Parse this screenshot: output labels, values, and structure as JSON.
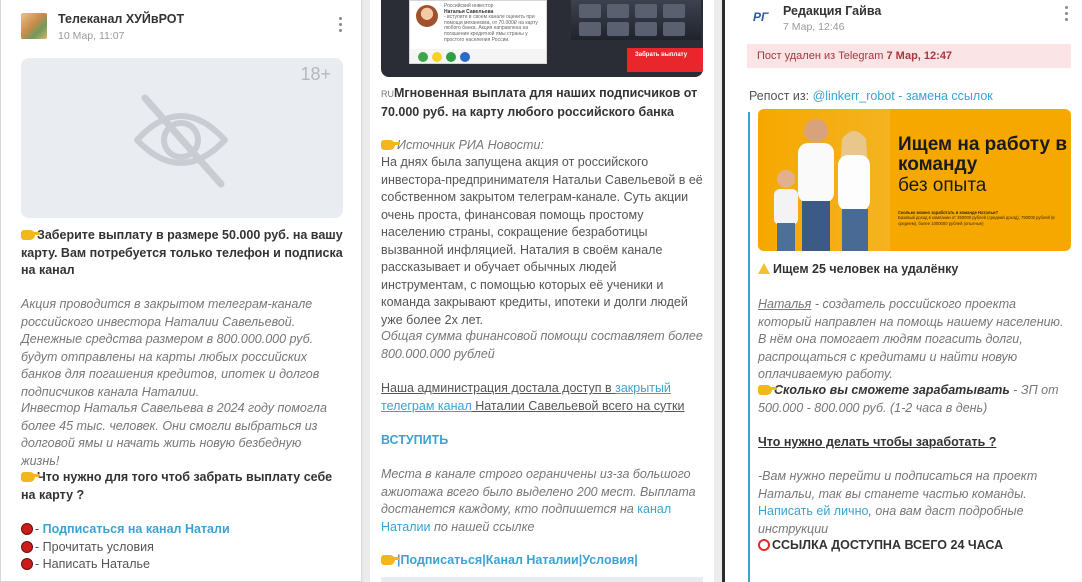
{
  "left_card": {
    "channel_name": "Телеканал ХУЙвРОТ",
    "time": "10 Мар, 11:07",
    "age_badge": "18+",
    "headline": "Заберите выплату в размере 50.000 руб. на вашу карту. Вам потребуется только телефон и подписка на канал",
    "para1": "Акция проводится в закрытом телеграм-канале российского инвестора Наталии Савельевой. Денежные средства размером в 800.000.000 руб. будут отправлены на карты любых российских банков для погашения кредитов, ипотек и долгов подписчиков канала Наталии.",
    "para2": "Инвестор Наталья Савельева в 2024 году помогла более 45 тыс. человек. Они смогли выбраться из долговой ямы и начать жить новую безбедную жизнь!",
    "question": "Что нужно для того чтоб забрать выплату себе на карту ?",
    "steps": [
      {
        "prefix": "- ",
        "text": "Подписаться на канал Натали"
      },
      {
        "prefix": "- ",
        "text": "Прочитать условия"
      },
      {
        "prefix": "- ",
        "text": "Написать Наталье"
      }
    ],
    "icons": {
      "menu": "kebab-menu-icon",
      "hidden": "eye-off-icon",
      "pointer": "pointing-hand-emoji",
      "bullet": "red-circle-emoji"
    }
  },
  "middle_card": {
    "image": {
      "investor_label": "Российский инвестор",
      "investor_name": "Наталья Савельева",
      "investor_text": "- вступите в своем канале оценить при помощи механизма, от 70.000₽ на карту любого банка. Акция направлена на погашение кредитной ямы страны у простого населения России.",
      "button_text": "Забрать выплату"
    },
    "headline_prefix": "RU",
    "headline": "Мгновенная выплата для наших подписчиков от 70.000 руб. на карту любого российского банка",
    "source": "Источник РИА Новости:",
    "para1": "На днях была запущена акция от российского инвестора-предпринимателя Натальи Савельевой в её собственном закрытом телеграм-канале. Суть акции очень проста, финансовая помощь простому населению страны, сокращение безработицы вызванной инфляцией. Наталия в своём канале рассказывает и обучает обычных людей инструментам, с помощью которых её ученики и команда закрывают кредиты, ипотеки и долги людей уже более 2х лет.",
    "para2": "Общая сумма финансовой помощи составляет более 800.000.000 рублей",
    "access_pre": "Наша администрация достала доступ в ",
    "access_link": "закрытый телеграм канал",
    "access_post": " Наталии Савельевой всего на сутки",
    "join": "ВСТУПИТЬ",
    "places_pre": "Места в канале строго ограничены из-за большого ажиотажа всего было выделено 200 мест. Выплата достанется каждому, кто подпишется на ",
    "places_link": "канал Наталии",
    "places_post": " по нашей ссылке",
    "links_line": "|Подписаться|Канал Наталии|Условия|"
  },
  "right_card": {
    "logo": "РГ",
    "channel_name": "Редакция Гайва",
    "time": "7 Мар, 12:46",
    "deleted_text": "Пост удален из Telegram ",
    "deleted_time": "7 Мар, 12:47",
    "repost_label": "Репост из: ",
    "repost_source": "@linkerr_robot - замена ссылок",
    "ad": {
      "title": "Ищем на работу в команду",
      "subtitle": "без опыта",
      "fine1": "Сколько можно заработать в команде Натальи?",
      "fine2": "Базовый доход в компании от 350000 рублей (средний доход), 750000 рублей (в среднем), более 1000000 рублей (опытные)"
    },
    "heading1": "Ищем 25 человек на удалёнку",
    "p1_link": "Наталья",
    "p1_text": " - создатель российского проекта который направлен на помощь нашему населению. В нём она помогает людям погасить долги, распрощаться с кредитами и найти новую оплачиваемую работу.",
    "earn_bold": "Сколько вы сможете зарабатывать",
    "earn_text": " - ЗП от 500.000 - 800.000 руб. (1-2 часа в день)",
    "todo": "Что нужно делать чтобы заработать ?",
    "p2_pre": "-Вам нужно перейти и подписаться на проект Натальи, так вы станете частью команды. ",
    "p2_link": "Написать ей лично",
    "p2_post": ", она вам даст подробные инструкции",
    "timer_heading": "ССЫЛКА ДОСТУПНА ВСЕГО 24 ЧАСА"
  },
  "colors": {
    "link": "#3aa3d3",
    "deleted_bg": "#fbe4e6",
    "deleted_text": "#a33a3f",
    "red_button": "#e8262c",
    "ad_bg": "#f6a800"
  }
}
